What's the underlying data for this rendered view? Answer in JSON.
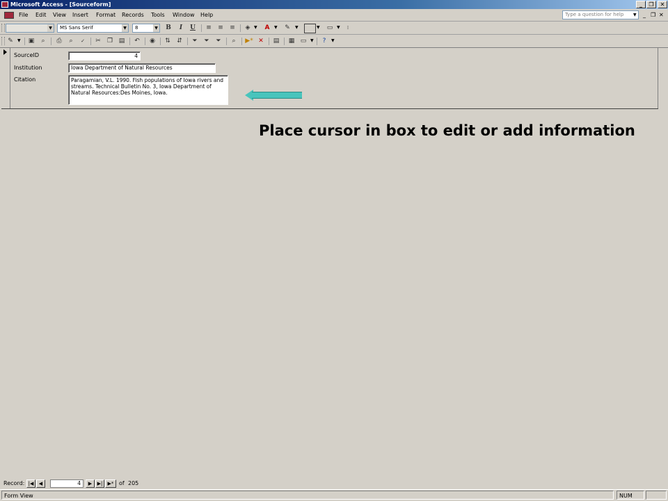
{
  "window": {
    "title": "Microsoft Access - [Sourceform]",
    "minimize": "_",
    "restore": "❐",
    "close": "✕"
  },
  "menubar": {
    "items": [
      "File",
      "Edit",
      "View",
      "Insert",
      "Format",
      "Records",
      "Tools",
      "Window",
      "Help"
    ],
    "help_placeholder": "Type a question for help",
    "doc_minimize": "_",
    "doc_restore": "❐",
    "doc_close": "✕"
  },
  "formatting_toolbar": {
    "object": "",
    "font": "MS Sans Serif",
    "size": "8",
    "bold": "B",
    "italic": "I",
    "underline": "U"
  },
  "form": {
    "fields": [
      {
        "label": "SourceID",
        "value": "4"
      },
      {
        "label": "Institution",
        "value": "Iowa Department of Natural Resources"
      },
      {
        "label": "Citation",
        "value": "Paragamian, V.L. 1990. Fish populations of Iowa rivers and streams. Technical Bulletin No. 3, Iowa Department of Natural Resources:Des Moines, Iowa."
      }
    ]
  },
  "annotation": {
    "text": "Place cursor in box to edit or add information",
    "arrow_color": "#48c4bc"
  },
  "navigation": {
    "label": "Record:",
    "first": "|◀",
    "prev": "◀",
    "current": "4",
    "next": "▶",
    "last": "▶|",
    "new": "▶*",
    "of_label": "of",
    "total": "205"
  },
  "statusbar": {
    "mode": "Form View",
    "num": "NUM"
  }
}
